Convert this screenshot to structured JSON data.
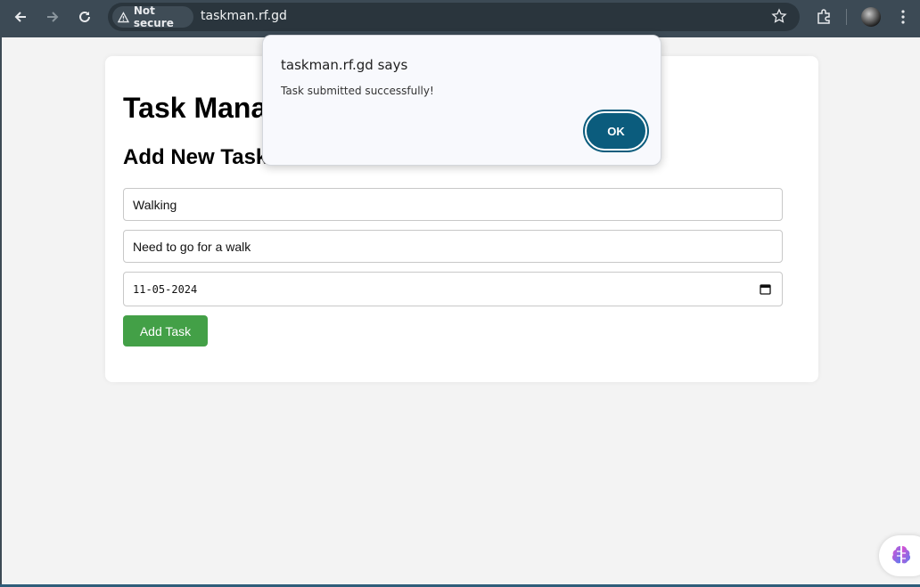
{
  "browser": {
    "security_label": "Not secure",
    "url": "taskman.rf.gd"
  },
  "page": {
    "title": "Task Mana",
    "subtitle": "Add New Task",
    "task_title_value": "Walking",
    "task_description_value": "Need to go for a walk",
    "task_date_value": "11-05-2024",
    "add_button_label": "Add Task"
  },
  "dialog": {
    "title": "taskman.rf.gd says",
    "message": "Task submitted successfully!",
    "ok_label": "OK"
  },
  "colors": {
    "toolbar": "#3c4a55",
    "add_button": "#43a047",
    "ok_button": "#0b5c7d"
  }
}
